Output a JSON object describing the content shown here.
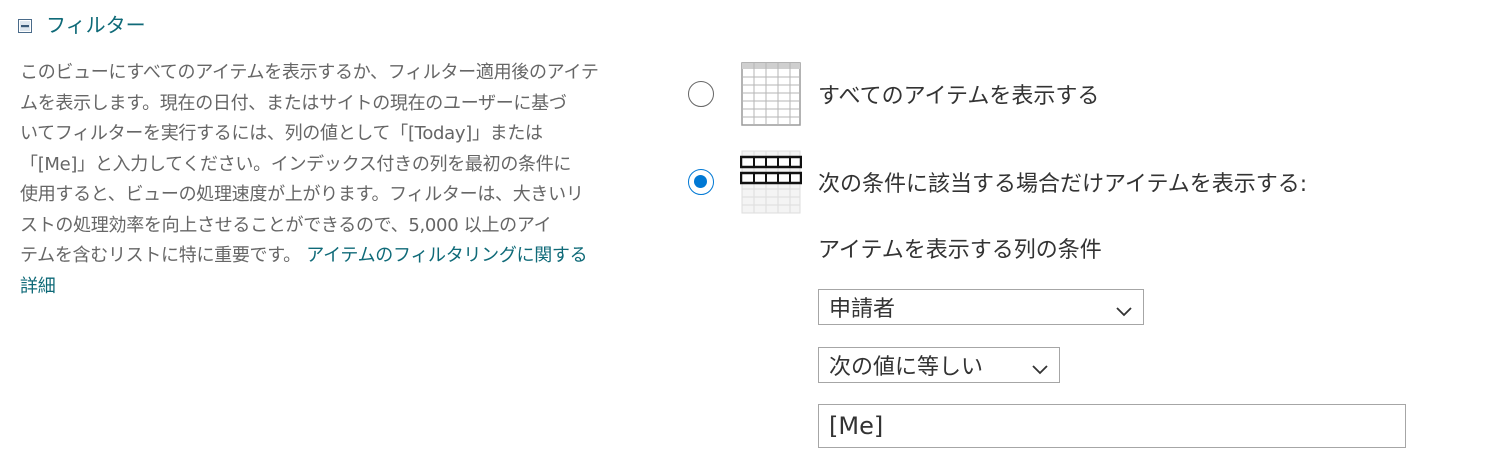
{
  "section": {
    "title": "フィルター",
    "collapse_icon": "minus-box-icon"
  },
  "description": {
    "lines": [
      "このビューにすべてのアイテムを表示するか、フィルター適用後のアイテ",
      "ムを表示します。現在の日付、またはサイトの現在のユーザーに基づ",
      "いてフィルターを実行するには、列の値として「[Today]」または",
      "「[Me]」と入力してください。インデックス付きの列を最初の条件に",
      "使用すると、ビューの処理速度が上がります。フィルターは、大きいリ",
      "ストの処理効率を向上させることができるので、5,000 以上のアイ",
      "テムを含むリストに特に重要です。"
    ],
    "link_text": "アイテムのフィルタリングに関する",
    "link_text_2": "詳細"
  },
  "options": {
    "show_all_label": "すべてのアイテムを表示する",
    "show_filtered_label": "次の条件に該当する場合だけアイテムを表示する:",
    "selected": "show_filtered"
  },
  "condition": {
    "label": "アイテムを表示する列の条件",
    "column_selected": "申請者",
    "operator_selected": "次の値に等しい",
    "value": "[Me]"
  },
  "colors": {
    "accent": "#0078d4",
    "link": "#0f6a78",
    "text": "#333333",
    "muted_text": "#666666"
  }
}
